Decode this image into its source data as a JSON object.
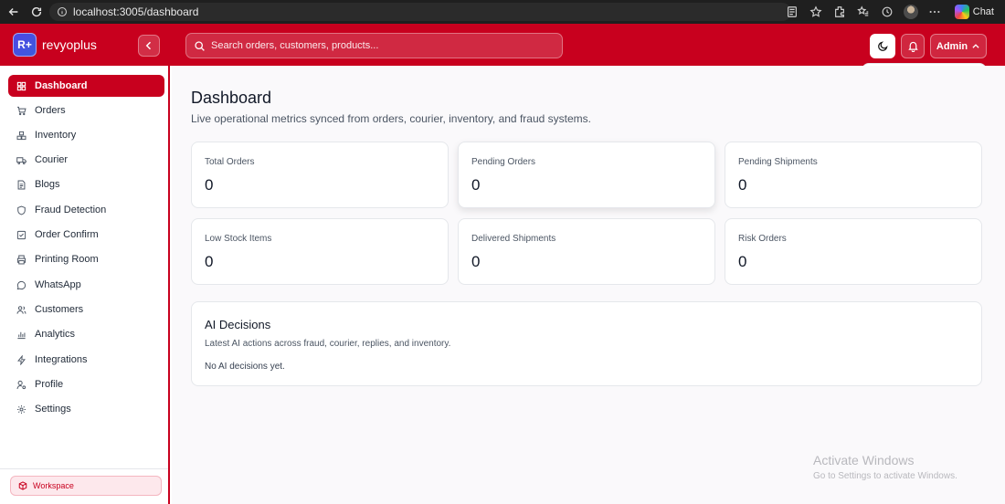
{
  "browser": {
    "url": "localhost:3005/dashboard",
    "chat_label": "Chat"
  },
  "header": {
    "logo_text": "R+",
    "brand_name": "revyoplus",
    "search_placeholder": "Search orders, customers, products...",
    "admin_label": "Admin",
    "accent_color": "#c8001e"
  },
  "sidebar": {
    "items": [
      {
        "label": "Dashboard",
        "icon": "grid-icon",
        "active": true
      },
      {
        "label": "Orders",
        "icon": "cart-icon"
      },
      {
        "label": "Inventory",
        "icon": "boxes-icon"
      },
      {
        "label": "Courier",
        "icon": "truck-icon"
      },
      {
        "label": "Blogs",
        "icon": "document-icon"
      },
      {
        "label": "Fraud Detection",
        "icon": "shield-icon"
      },
      {
        "label": "Order Confirm",
        "icon": "checkbox-icon"
      },
      {
        "label": "Printing Room",
        "icon": "printer-icon"
      },
      {
        "label": "WhatsApp",
        "icon": "chat-bubble-icon"
      },
      {
        "label": "Customers",
        "icon": "users-icon"
      },
      {
        "label": "Analytics",
        "icon": "bar-chart-icon"
      },
      {
        "label": "Integrations",
        "icon": "lightning-icon"
      },
      {
        "label": "Profile",
        "icon": "user-cog-icon"
      },
      {
        "label": "Settings",
        "icon": "gear-icon"
      }
    ],
    "workspace_label": "Workspace"
  },
  "main": {
    "title": "Dashboard",
    "subtitle": "Live operational metrics synced from orders, courier, inventory, and fraud systems.",
    "cards": [
      {
        "label": "Total Orders",
        "value": "0"
      },
      {
        "label": "Pending Orders",
        "value": "0"
      },
      {
        "label": "Pending Shipments",
        "value": "0"
      },
      {
        "label": "Low Stock Items",
        "value": "0"
      },
      {
        "label": "Delivered Shipments",
        "value": "0"
      },
      {
        "label": "Risk Orders",
        "value": "0"
      }
    ],
    "ai": {
      "title": "AI Decisions",
      "subtitle": "Latest AI actions across fraud, courier, replies, and inventory.",
      "empty": "No AI decisions yet."
    }
  },
  "watermark": {
    "title": "Activate Windows",
    "subtitle": "Go to Settings to activate Windows."
  }
}
